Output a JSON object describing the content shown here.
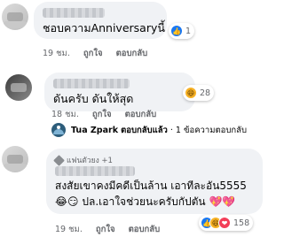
{
  "comments": [
    {
      "text": "ชอบความAnniversaryนี้",
      "time": "19 ชม.",
      "like": "ถูกใจ",
      "reply": "ตอบกลับ",
      "reaction_count": "1"
    },
    {
      "text": "ดันครับ ดันให้สุด",
      "time": "18 ชม.",
      "like": "ถูกใจ",
      "reply": "ตอบกลับ",
      "reaction_count": "28",
      "reply_summary": {
        "author": "Tua Zpark",
        "action": "ตอบกลับแล้ว",
        "count": "· 1 ข้อความตอบกลับ"
      }
    },
    {
      "badge": "แฟนตัวยง +1",
      "line1": "สงสัยเขาคงมีคดีเป็นล้าน เอาทีละอัน5555",
      "line2_prefix": "😂😏",
      "line2_text": "ปล.เอาใจช่วยนะครับกัปตัน",
      "line2_suffix": "💖💖",
      "time": "19 ชม.",
      "like": "ถูกใจ",
      "reply": "ตอบกลับ",
      "reaction_count": "158"
    }
  ]
}
